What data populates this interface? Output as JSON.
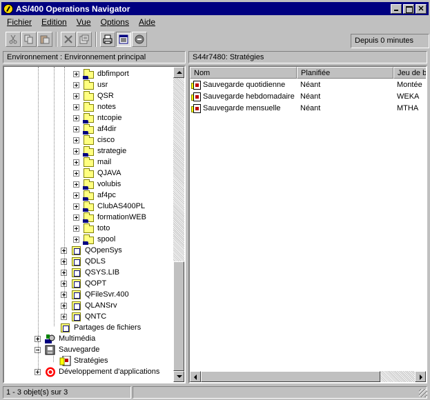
{
  "window": {
    "title": "AS/400 Operations Navigator"
  },
  "menu": [
    {
      "label": "Fichier"
    },
    {
      "label": "Edition"
    },
    {
      "label": "Vue"
    },
    {
      "label": "Options"
    },
    {
      "label": "Aide"
    }
  ],
  "toolbar": {
    "buttons": [
      "cut-icon",
      "copy-icon",
      "paste-icon",
      "delete-icon",
      "properties-icon",
      "print-icon",
      "details-view-icon",
      "stop-icon"
    ],
    "since": "Depuis 0 minutes"
  },
  "left_header": "Environnement : Environnement principal",
  "right_header": "S44r7480:  Stratégies",
  "tree": {
    "folders": [
      {
        "label": "dbfimport",
        "icon": "shared-folder-icon"
      },
      {
        "label": "usr",
        "icon": "folder-icon"
      },
      {
        "label": "QSR",
        "icon": "folder-icon"
      },
      {
        "label": "notes",
        "icon": "folder-icon"
      },
      {
        "label": "ntcopie",
        "icon": "shared-folder-icon"
      },
      {
        "label": "af4dir",
        "icon": "shared-folder-icon"
      },
      {
        "label": "cisco",
        "icon": "folder-icon"
      },
      {
        "label": "strategie",
        "icon": "shared-folder-icon"
      },
      {
        "label": "mail",
        "icon": "folder-icon"
      },
      {
        "label": "QJAVA",
        "icon": "folder-icon"
      },
      {
        "label": "volubis",
        "icon": "shared-folder-icon"
      },
      {
        "label": "af4pc",
        "icon": "shared-folder-icon"
      },
      {
        "label": "ClubAS400PL",
        "icon": "shared-folder-icon"
      },
      {
        "label": "formationWEB",
        "icon": "shared-folder-icon"
      },
      {
        "label": "toto",
        "icon": "folder-icon"
      },
      {
        "label": "spool",
        "icon": "shared-folder-icon"
      }
    ],
    "filesystems": [
      {
        "label": "QOpenSys"
      },
      {
        "label": "QDLS"
      },
      {
        "label": "QSYS.LIB"
      },
      {
        "label": "QOPT"
      },
      {
        "label": "QFileSvr.400"
      },
      {
        "label": "QLANSrv"
      },
      {
        "label": "QNTC"
      }
    ],
    "partages": "Partages de fichiers",
    "multimedia": "Multimédia",
    "sauvegarde": "Sauvegarde",
    "strategies": "Stratégies",
    "developpement": "Développement d'applications"
  },
  "list": {
    "columns": [
      "Nom",
      "Planifiée",
      "Jeu de b"
    ],
    "rows": [
      {
        "nom": "Sauvegarde quotidienne",
        "planifiee": "Néant",
        "jeu": "Montée"
      },
      {
        "nom": "Sauvegarde hebdomadaire",
        "planifiee": "Néant",
        "jeu": "WEKA"
      },
      {
        "nom": "Sauvegarde mensuelle",
        "planifiee": "Néant",
        "jeu": "MTHA"
      }
    ]
  },
  "status": {
    "text": "1 - 3 objet(s) sur 3"
  }
}
